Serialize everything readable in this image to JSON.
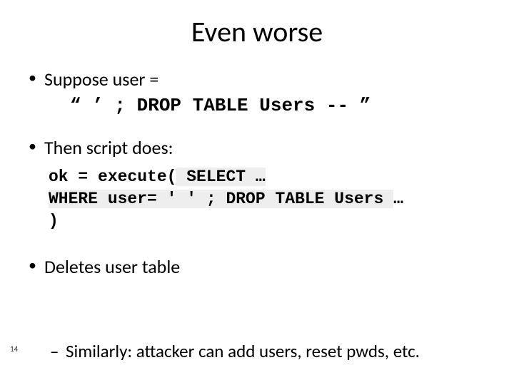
{
  "title": "Even worse",
  "bullets": {
    "b1": "Suppose user =",
    "b1_sub": "“   ’ ;  DROP TABLE  Users  --      ”",
    "b2": "Then script does:",
    "b3": "Deletes user table"
  },
  "code": {
    "l1a": "ok = execute(",
    "l1b": " SELECT …",
    "l2a": "   WHERE user= ",
    "l2b": "' ' ; DROP TABLE Users ",
    "l2c": " …",
    "l3": ")"
  },
  "footer": {
    "dash": "–",
    "text": "Similarly:   attacker can add users,  reset pwds,  etc."
  },
  "page_number": "14"
}
